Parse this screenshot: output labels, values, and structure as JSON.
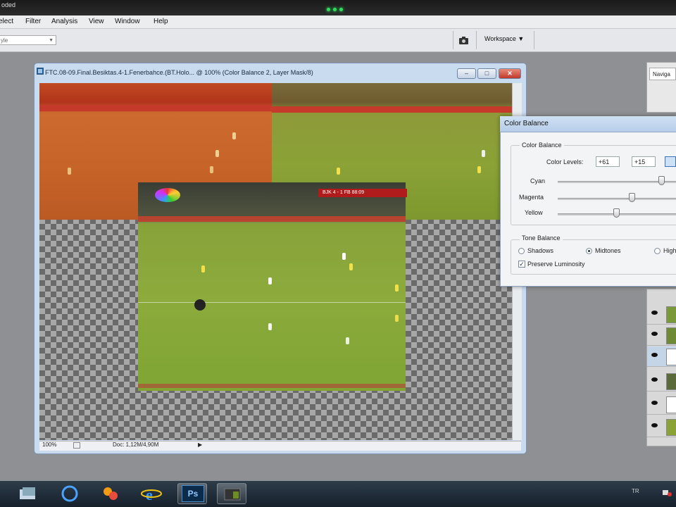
{
  "app": {
    "title_fragment": "oded"
  },
  "menu": [
    "elect",
    "Filter",
    "Analysis",
    "View",
    "Window",
    "Help"
  ],
  "options_bar": {
    "style_select": "yle",
    "workspace_label": "Workspace ▼"
  },
  "document": {
    "title": "FTC.08-09.Final.Besiktas.4-1.Fenerbahce.(BT.Holo... @ 100% (Color Balance 2, Layer Mask/8)",
    "zoom": "100%",
    "doc_info": "Doc: 1,12M/4,90M",
    "scorebug_text": "BJK 4 - 1 FB 88:09"
  },
  "color_balance": {
    "title": "Color Balance",
    "group_label": "Color Balance",
    "levels_label": "Color Levels:",
    "levels": [
      "+61",
      "+15"
    ],
    "sliders": [
      {
        "label": "Cyan",
        "value": 61
      },
      {
        "label": "Magenta",
        "value": 15
      },
      {
        "label": "Yellow",
        "value": 0
      }
    ],
    "tone_label": "Tone Balance",
    "tones": [
      {
        "label": "Shadows",
        "selected": false
      },
      {
        "label": "Midtones",
        "selected": true
      },
      {
        "label": "High",
        "selected": false
      }
    ],
    "preserve_label": "Preserve Luminosity",
    "preserve_checked": true
  },
  "panels": {
    "navigator_tab": "Naviga"
  },
  "taskbar": {
    "ps_label": "Ps",
    "tray_lang": "TR"
  }
}
